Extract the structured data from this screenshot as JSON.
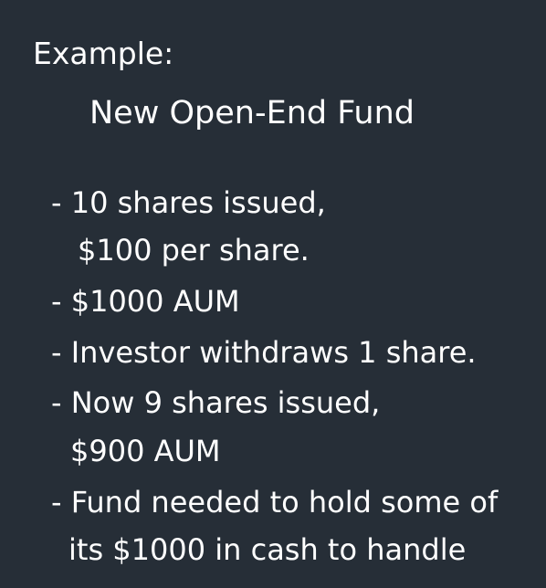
{
  "heading": "Example:",
  "subtitle": "New Open-End Fund",
  "bullets": [
    {
      "lines": [
        "- 10 shares issued,",
        "$100 per share."
      ]
    },
    {
      "lines": [
        "- $1000 AUM"
      ]
    },
    {
      "lines": [
        "- Investor withdraws 1 share."
      ]
    },
    {
      "lines": [
        "- Now 9 shares issued,",
        "$900 AUM"
      ]
    },
    {
      "lines": [
        "- Fund needed to hold some of",
        "its $1000 in cash to handle"
      ]
    }
  ]
}
